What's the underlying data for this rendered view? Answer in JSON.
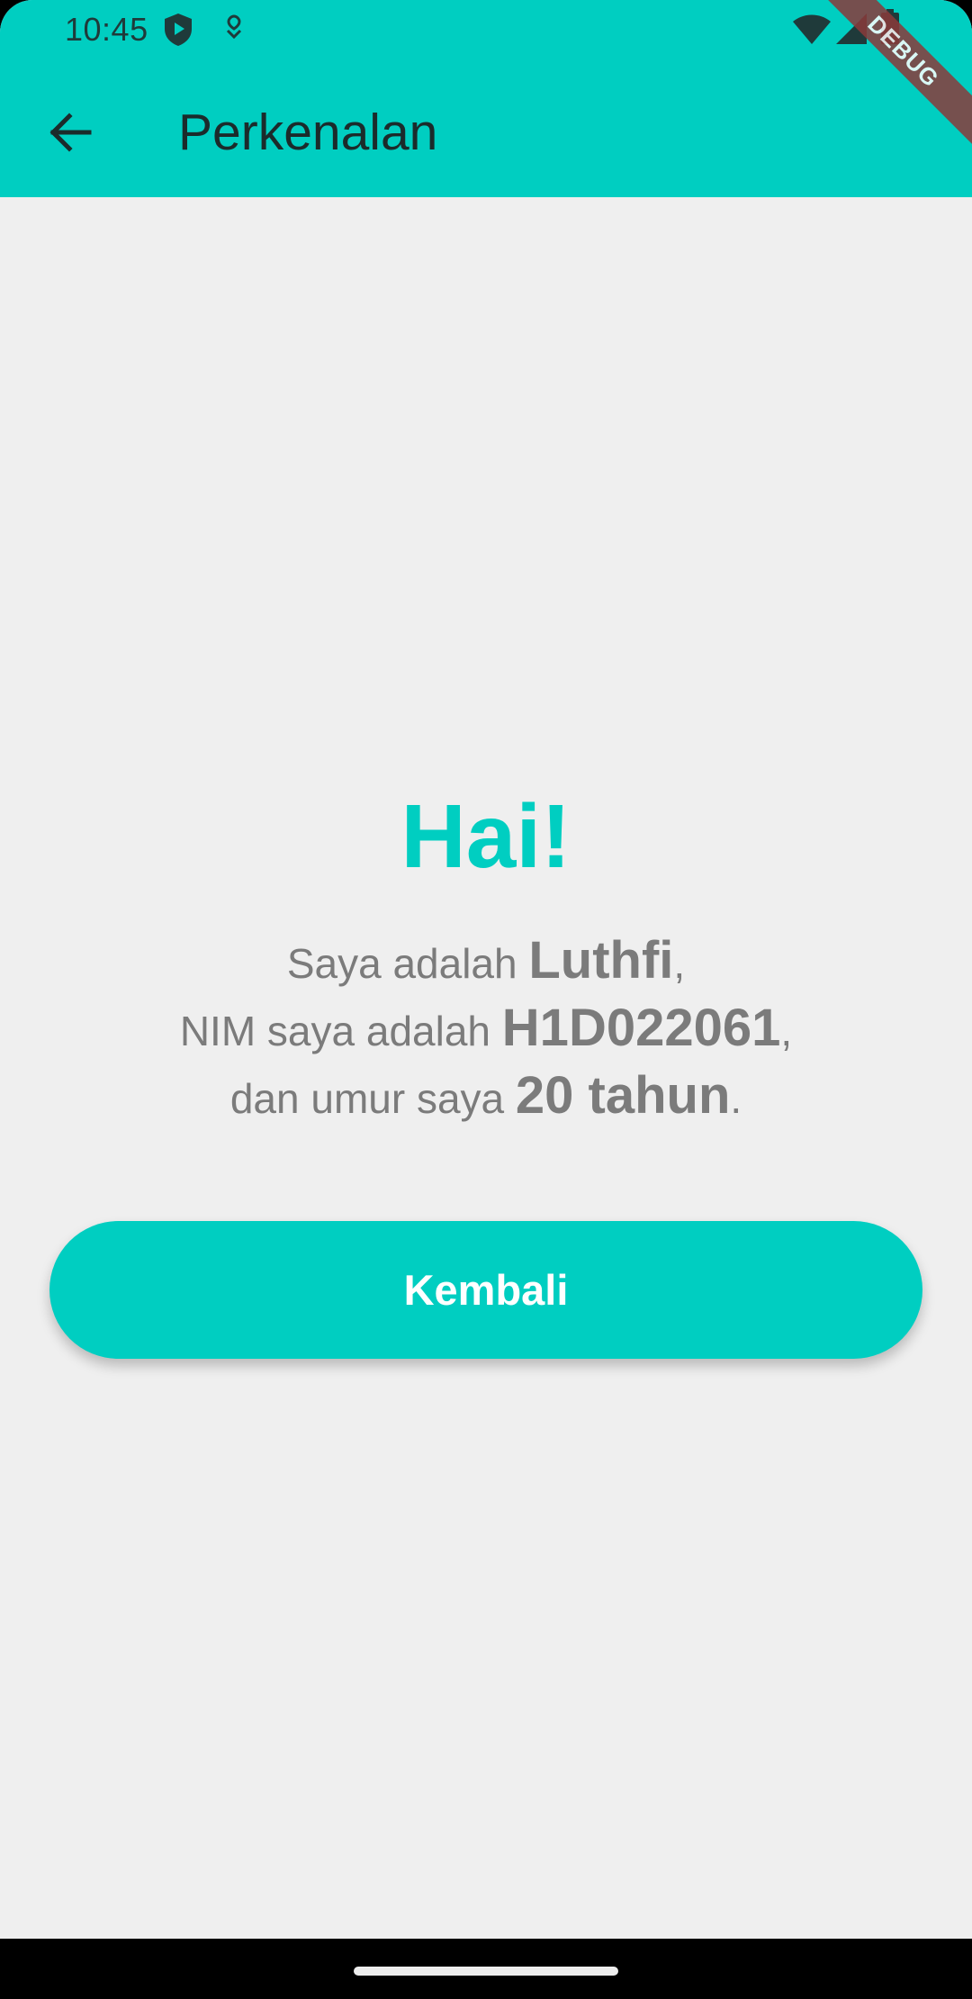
{
  "status_bar": {
    "time": "10:45",
    "icons": [
      "play-shield-icon",
      "notification-icon",
      "wifi-icon",
      "signal-icon",
      "battery-icon"
    ]
  },
  "app_bar": {
    "title": "Perkenalan",
    "back_icon": "arrow-back-icon"
  },
  "debug_banner": {
    "label": "DEBUG"
  },
  "content": {
    "greeting": "Hai!",
    "line1_prefix": "Saya adalah ",
    "name": "Luthfi",
    "line1_suffix": ",",
    "line2_prefix": "NIM saya adalah ",
    "nim": "H1D022061",
    "line2_suffix": ",",
    "line3_prefix": "dan umur saya ",
    "age": "20 tahun",
    "line3_suffix": "."
  },
  "button": {
    "label": "Kembali"
  },
  "colors": {
    "primary": "#00cec1",
    "background": "#efefef",
    "text_muted": "#7b7b7b"
  }
}
